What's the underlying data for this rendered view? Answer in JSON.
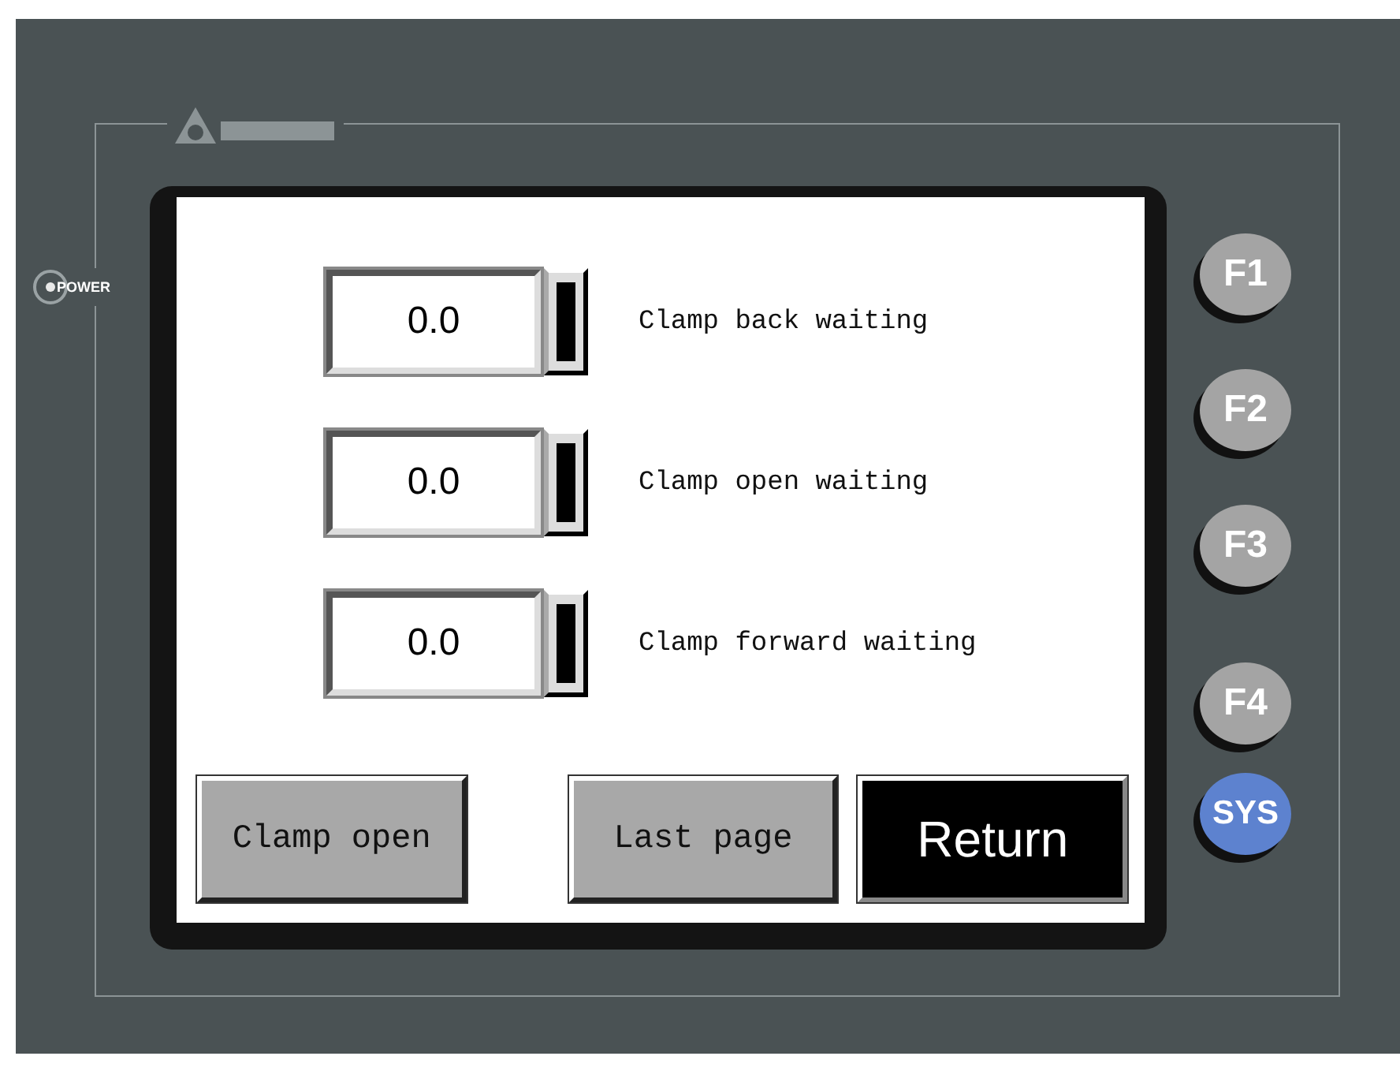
{
  "power_label": "POWER",
  "screen": {
    "rows": [
      {
        "value": "0.0",
        "label": "Clamp back waiting"
      },
      {
        "value": "0.0",
        "label": "Clamp open waiting"
      },
      {
        "value": "0.0",
        "label": "Clamp forward waiting"
      }
    ],
    "buttons": [
      {
        "label": "Clamp open",
        "kind": "normal"
      },
      {
        "label": "Last page",
        "kind": "normal"
      },
      {
        "label": "Return",
        "kind": "dark"
      }
    ]
  },
  "keys": [
    {
      "label": "F1",
      "kind": "function"
    },
    {
      "label": "F2",
      "kind": "function"
    },
    {
      "label": "F3",
      "kind": "function"
    },
    {
      "label": "F4",
      "kind": "function"
    },
    {
      "label": "SYS",
      "kind": "system"
    }
  ]
}
